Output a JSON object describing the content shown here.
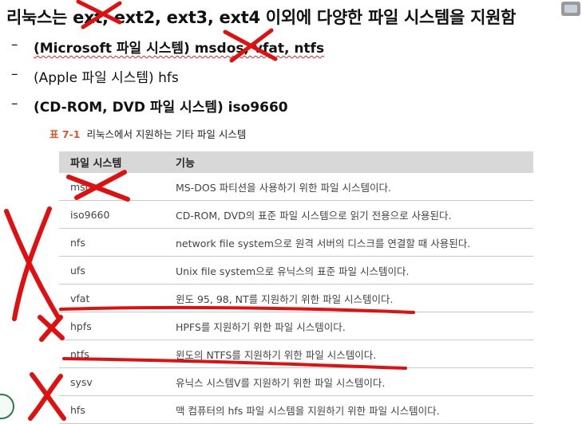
{
  "headline": "리눅스는 ext, ext2, ext3, ext4 이외에 다양한 파일 시스템을 지원함",
  "bullets": [
    {
      "dash": "–",
      "text": "(Microsoft 파일 시스템) msdos, vfat, ntfs",
      "bold": true
    },
    {
      "dash": "–",
      "text": "(Apple 파일 시스템) hfs",
      "bold": false
    },
    {
      "dash": "–",
      "text": "(CD-ROM, DVD 파일 시스템) iso9660",
      "bold": true
    }
  ],
  "caption": {
    "number": "표 7-1",
    "title": "리눅스에서 지원하는 기타 파일 시스템"
  },
  "table": {
    "headers": [
      "파일 시스템",
      "기능"
    ],
    "rows": [
      [
        "msdos",
        "MS-DOS 파티션을 사용하기 위한 파일 시스템이다."
      ],
      [
        "iso9660",
        "CD-ROM, DVD의 표준 파일 시스템으로 읽기 전용으로 사용된다."
      ],
      [
        "nfs",
        "network file system으로 원격 서버의 디스크를 연결할 때 사용된다."
      ],
      [
        "ufs",
        "Unix file system으로 유닉스의 표준 파일 시스템이다."
      ],
      [
        "vfat",
        "윈도 95, 98, NT를 지원하기 위한 파일 시스템이다."
      ],
      [
        "hpfs",
        "HPFS를 지원하기 위한 파일 시스템이다."
      ],
      [
        "ntfs",
        "윈도의 NTFS를 지원하기 위한 파일 시스템이다."
      ],
      [
        "sysv",
        "유닉스 시스템V를 지원하기 위한 파일 시스템이다."
      ],
      [
        "hfs",
        "맥 컴퓨터의 hfs 파일 시스템을 지원하기 위한 파일 시스템이다."
      ]
    ]
  },
  "colors": {
    "annotation": "#e01010",
    "caption_accent": "#e0552a",
    "header_bg": "#d8d8d8"
  }
}
